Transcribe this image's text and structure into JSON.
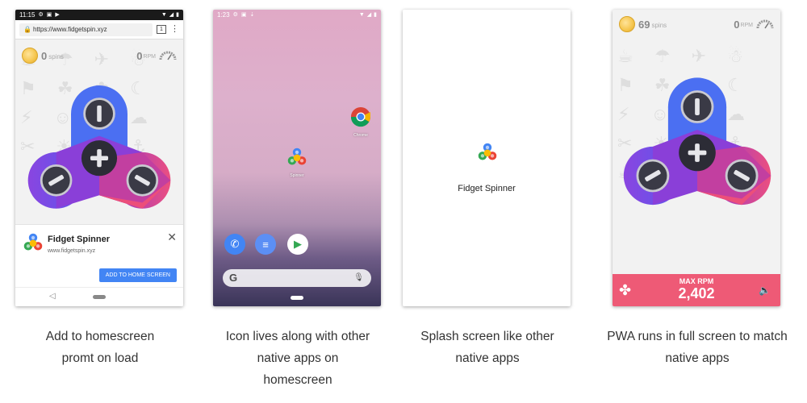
{
  "colors": {
    "accent_pink": "#ee5a76",
    "button_blue": "#4285f4",
    "coin_gold": "#f5c54d"
  },
  "panel1": {
    "status_time": "11:15",
    "url": "https://www.fidgetspin.xyz",
    "tab_count": "1",
    "spins_value": "0",
    "spins_unit": "spins",
    "rpm_value": "0",
    "rpm_unit": "RPM",
    "prompt": {
      "title": "Fidget Spinner",
      "url": "www.fidgetspin.xyz",
      "button_label": "ADD TO HOME SCREEN"
    }
  },
  "panel2": {
    "status_time": "1:23",
    "chrome_label": "Chrome",
    "spinner_label": "Spinner",
    "search_letter": "G"
  },
  "panel3": {
    "title": "Fidget Spinner"
  },
  "panel4": {
    "spins_value": "69",
    "spins_unit": "spins",
    "rpm_value": "0",
    "rpm_unit": "RPM",
    "max_rpm_label": "MAX RPM",
    "max_rpm_value": "2,402"
  },
  "captions": [
    "Add to homescreen promt on load",
    "Icon lives along with other native apps on homescreen",
    "Splash screen like other native apps",
    "PWA runs in full screen to match native apps"
  ]
}
